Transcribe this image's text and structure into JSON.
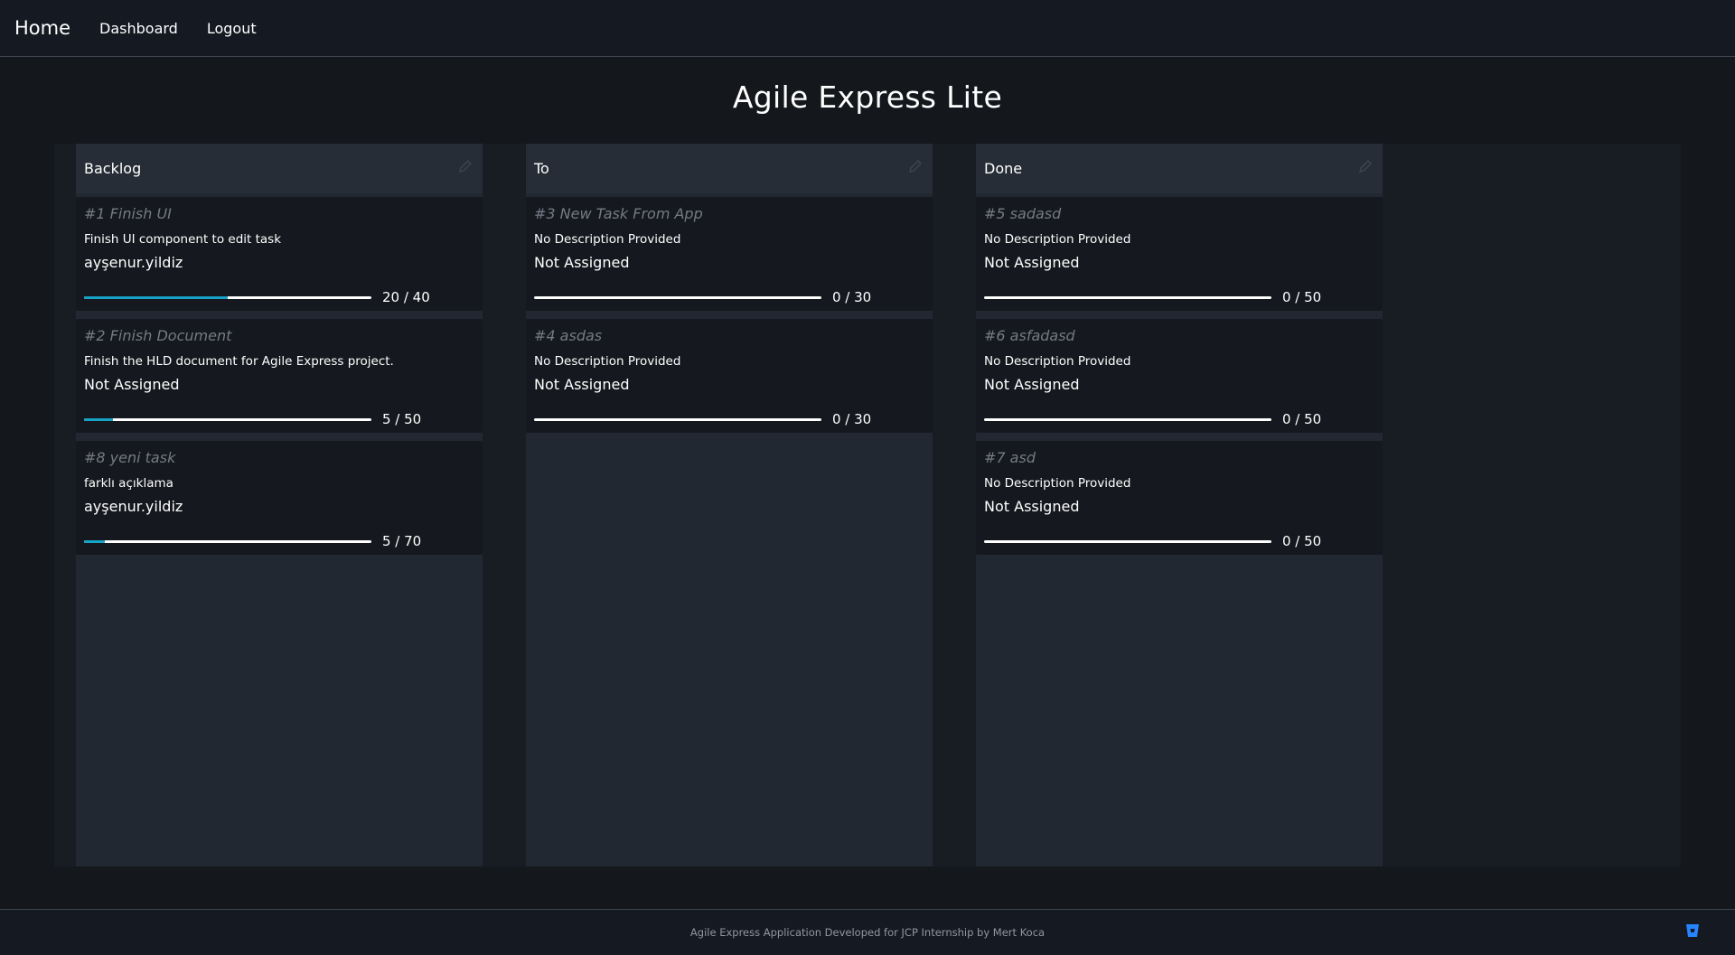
{
  "nav": {
    "brand": "Home",
    "links": [
      "Dashboard",
      "Logout"
    ]
  },
  "page": {
    "title": "Agile Express Lite"
  },
  "columns": [
    {
      "name": "Backlog",
      "cards": [
        {
          "title": "#1 Finish UI",
          "description": "Finish UI component to edit task",
          "assignee": "ayşenur.yildiz",
          "progress_done": 20,
          "progress_total": 40,
          "progress_label": "20 / 40"
        },
        {
          "title": "#2 Finish Document",
          "description": "Finish the HLD document for Agile Express project.",
          "assignee": "Not Assigned",
          "progress_done": 5,
          "progress_total": 50,
          "progress_label": "5 / 50"
        },
        {
          "title": "#8 yeni task",
          "description": "farklı açıklama",
          "assignee": "ayşenur.yildiz",
          "progress_done": 5,
          "progress_total": 70,
          "progress_label": "5 / 70"
        }
      ]
    },
    {
      "name": "To",
      "cards": [
        {
          "title": "#3 New Task From App",
          "description": "No Description Provided",
          "assignee": "Not Assigned",
          "progress_done": 0,
          "progress_total": 30,
          "progress_label": "0 / 30"
        },
        {
          "title": "#4 asdas",
          "description": "No Description Provided",
          "assignee": "Not Assigned",
          "progress_done": 0,
          "progress_total": 30,
          "progress_label": "0 / 30"
        }
      ]
    },
    {
      "name": "Done",
      "cards": [
        {
          "title": "#5 sadasd",
          "description": "No Description Provided",
          "assignee": "Not Assigned",
          "progress_done": 0,
          "progress_total": 50,
          "progress_label": "0 / 50"
        },
        {
          "title": "#6 asfadasd",
          "description": "No Description Provided",
          "assignee": "Not Assigned",
          "progress_done": 0,
          "progress_total": 50,
          "progress_label": "0 / 50"
        },
        {
          "title": "#7 asd",
          "description": "No Description Provided",
          "assignee": "Not Assigned",
          "progress_done": 0,
          "progress_total": 50,
          "progress_label": "0 / 50"
        }
      ]
    }
  ],
  "footer": {
    "text": "Agile Express Application Developed for JCP Internship by Mert Koca",
    "icon": "bitbucket-icon"
  },
  "colors": {
    "background": "#14171c",
    "board": "#181c23",
    "column": "#222831",
    "card": "#15181e",
    "progress_fill": "#17a2c8",
    "footer_icon": "#2684ff"
  }
}
